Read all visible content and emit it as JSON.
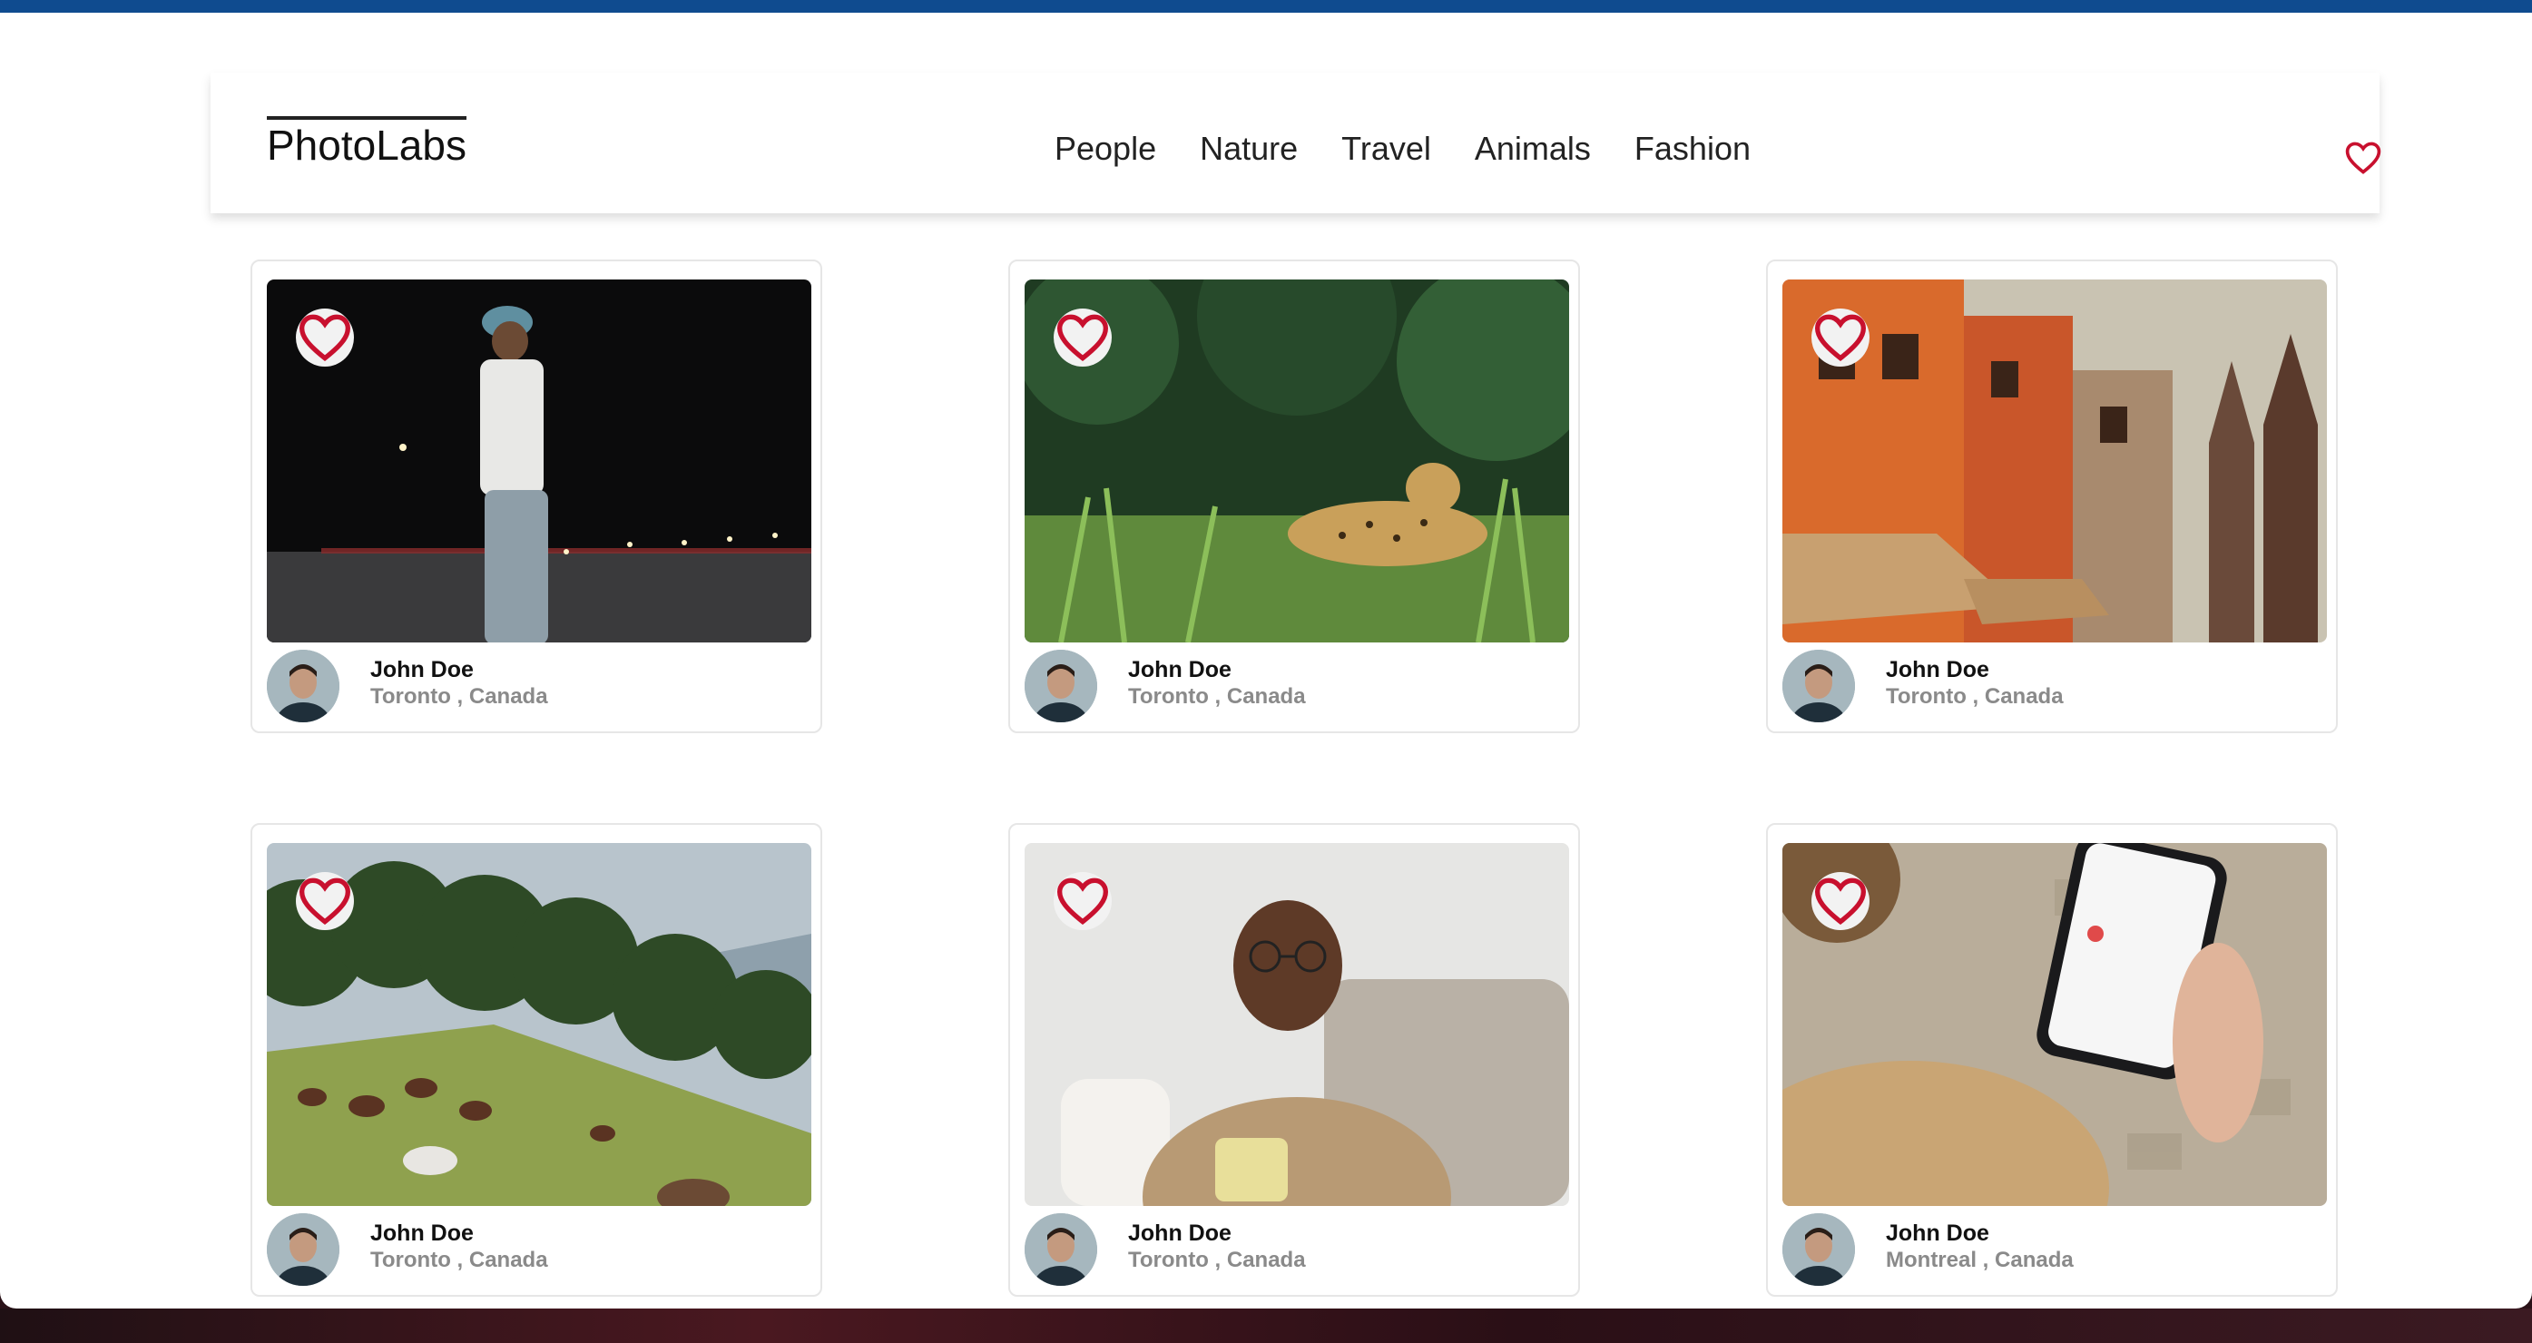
{
  "app": {
    "logo": "PhotoLabs"
  },
  "nav": {
    "topics": [
      "People",
      "Nature",
      "Travel",
      "Animals",
      "Fashion"
    ],
    "favourites_icon": "heart-outline-icon"
  },
  "colors": {
    "accent": "#c8102e",
    "top_bar": "#0f4b8f"
  },
  "photos": [
    {
      "subject": "man walking at night",
      "user": "John Doe",
      "city": "Toronto",
      "country": "Canada",
      "location": "Toronto , Canada",
      "liked": false
    },
    {
      "subject": "jaguar in grass",
      "user": "John Doe",
      "city": "Toronto",
      "country": "Canada",
      "location": "Toronto , Canada",
      "liked": false
    },
    {
      "subject": "colorful riverside buildings",
      "user": "John Doe",
      "city": "Toronto",
      "country": "Canada",
      "location": "Toronto , Canada",
      "liked": false
    },
    {
      "subject": "horses grazing on hillside",
      "user": "John Doe",
      "city": "Toronto",
      "country": "Canada",
      "location": "Toronto , Canada",
      "liked": false
    },
    {
      "subject": "smiling man with mug",
      "user": "John Doe",
      "city": "Toronto",
      "country": "Canada",
      "location": "Toronto , Canada",
      "liked": false
    },
    {
      "subject": "hand holding phone",
      "user": "John Doe",
      "city": "Montreal",
      "country": "Canada",
      "location": "Montreal , Canada",
      "liked": false
    }
  ]
}
